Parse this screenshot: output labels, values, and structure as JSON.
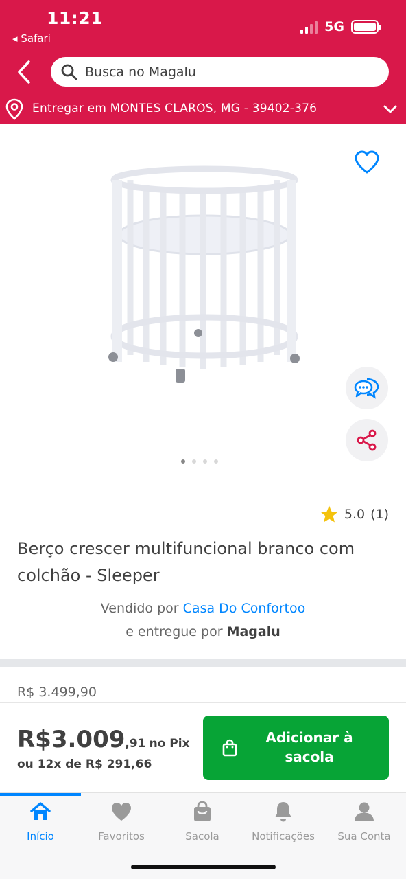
{
  "status_bar": {
    "time": "11:21",
    "back_app": "◂ Safari",
    "network": "5G",
    "signal_bars_lit": 2
  },
  "header": {
    "search_placeholder": "Busca no Magalu",
    "delivery_text": "Entregar em MONTES CLAROS, MG - 39402-376",
    "brand_color": "#d9184a"
  },
  "gallery": {
    "image_count": 4,
    "active_index": 0
  },
  "product": {
    "rating": "5.0",
    "rating_count": "(1)",
    "title": "Berço crescer multifuncional branco com colchão - Sleeper",
    "sold_by_prefix": "Vendido por",
    "seller_name": "Casa Do Confortoo",
    "delivered_by_prefix": "e entregue por",
    "delivered_by": "Magalu",
    "old_price": "R$ 3.499,90"
  },
  "buy_bar": {
    "price_integer": "R$3.009",
    "price_cents": ",91",
    "price_suffix": "no Pix",
    "installments": "ou 12x de R$ 291,66",
    "add_button": "Adicionar à sacola",
    "button_color": "#07a436"
  },
  "tabbar": {
    "items": [
      {
        "label": "Início",
        "icon": "home-icon",
        "active": true
      },
      {
        "label": "Favoritos",
        "icon": "heart-icon",
        "active": false
      },
      {
        "label": "Sacola",
        "icon": "bag-icon",
        "active": false
      },
      {
        "label": "Notificações",
        "icon": "bell-icon",
        "active": false
      },
      {
        "label": "Sua Conta",
        "icon": "user-icon",
        "active": false
      }
    ],
    "active_color": "#0086ff"
  }
}
